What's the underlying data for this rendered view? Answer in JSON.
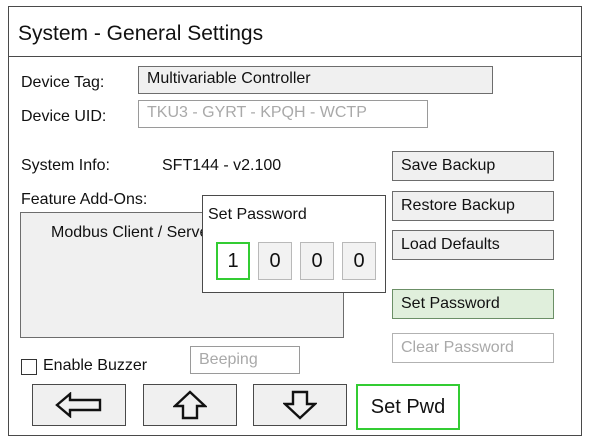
{
  "header": {
    "title": "System - General Settings"
  },
  "device": {
    "tag_label": "Device Tag:",
    "tag_value": "Multivariable Controller",
    "uid_label": "Device UID:",
    "uid_value": "TKU3 - GYRT - KPQH - WCTP"
  },
  "system_info": {
    "label": "System Info:",
    "value": "SFT144 - v2.100"
  },
  "addons": {
    "label": "Feature Add-Ons:",
    "items": [
      "Modbus Client / Server"
    ]
  },
  "buttons": {
    "save_backup": "Save Backup",
    "restore_backup": "Restore Backup",
    "load_defaults": "Load Defaults",
    "set_password": "Set Password",
    "clear_password": "Clear Password"
  },
  "buzzer": {
    "label": "Enable Buzzer",
    "checked": false,
    "mode_value": "Beeping"
  },
  "footer": {
    "back_icon": "arrow-left-icon",
    "up_icon": "arrow-up-icon",
    "down_icon": "arrow-down-icon",
    "action_label": "Set Pwd"
  },
  "popup": {
    "title": "Set Password",
    "digits": [
      "1",
      "0",
      "0",
      "0"
    ],
    "active_digit": 1
  },
  "colors": {
    "active_border": "#33cc33",
    "active_button_bg": "#e0efdc",
    "disabled_text": "#a9a9a9"
  }
}
